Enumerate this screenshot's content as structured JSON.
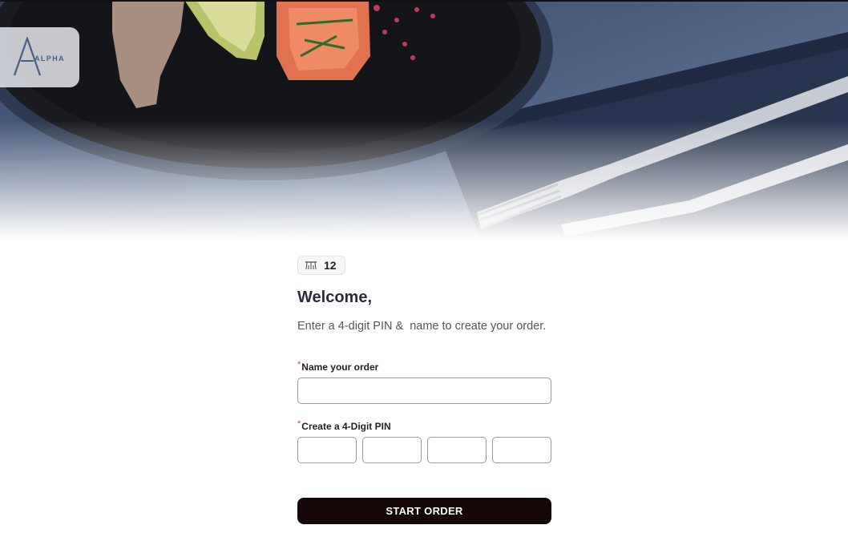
{
  "brand": {
    "name": "ALPHA",
    "accent": "#4a5d82"
  },
  "table": {
    "icon": "table-icon",
    "number": "12"
  },
  "welcome": {
    "heading": "Welcome,",
    "subtitle": "Enter a 4-digit PIN &  name to create your order."
  },
  "form": {
    "required_marker": "*",
    "name_label": "Name your order",
    "name_value": "",
    "pin_label": "Create a 4-Digit PIN",
    "pin_digits": [
      "",
      "",
      "",
      ""
    ]
  },
  "actions": {
    "start_label": "START ORDER",
    "start_color": "#150607"
  }
}
